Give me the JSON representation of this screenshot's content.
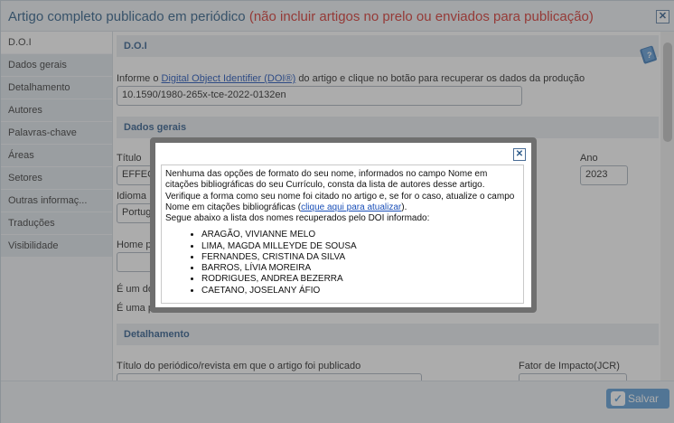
{
  "window": {
    "title": "Artigo completo publicado em periódico",
    "title_warning": "(não incluir artigos no prelo ou enviados para publicação)",
    "close_glyph": "✕"
  },
  "sidebar": {
    "items": [
      {
        "label": "D.O.I",
        "active": true
      },
      {
        "label": "Dados gerais"
      },
      {
        "label": "Detalhamento"
      },
      {
        "label": "Autores"
      },
      {
        "label": "Palavras-chave"
      },
      {
        "label": "Áreas"
      },
      {
        "label": "Setores"
      },
      {
        "label": "Outras informaç..."
      },
      {
        "label": "Traduções"
      },
      {
        "label": "Visibilidade"
      }
    ]
  },
  "doi_section": {
    "header": "D.O.I",
    "instruction_prefix": "Informe o",
    "instruction_link": "Digital Object Identifier (DOI®)",
    "instruction_suffix": "do artigo e clique no botão para recuperar os dados da produção",
    "doi_value": "10.1590/1980-265x-tce-2022-0132en"
  },
  "dados_gerais": {
    "header": "Dados gerais",
    "titulo_label": "Título",
    "titulo_value": "EFFEC",
    "ano_label": "Ano",
    "ano_value": "2023",
    "idioma_label": "Idioma",
    "idioma_value": "Portug",
    "homepage_label": "Home p",
    "e_um_label": "É um do",
    "e_uma_label": "É uma p"
  },
  "detalhamento": {
    "header": "Detalhamento",
    "periodico_label": "Título do periódico/revista em que o artigo foi publicado",
    "fator_label": "Fator de Impacto(JCR)"
  },
  "footer": {
    "save_label": "Salvar"
  },
  "modal": {
    "message_before_link": "Nenhuma das opções de formato do seu nome, informados no campo Nome em citações bibliográficas do seu Currículo, consta da lista de autores desse artigo. Verifique a forma como seu nome foi citado no artigo e, se for o caso, atualize o campo Nome em citações bibliográficas (",
    "link_text": "clique aqui para atualizar",
    "message_after_link": ").",
    "list_intro": "Segue abaixo a lista dos nomes recuperados pelo DOI informado:",
    "authors": [
      "ARAGÃO, VIVIANNE MELO",
      "LIMA, MAGDA MILLEYDE DE SOUSA",
      "FERNANDES, CRISTINA DA SILVA",
      "BARROS, LÍVIA MOREIRA",
      "RODRIGUES, ANDREA BEZERRA",
      "CAETANO, JOSELANY ÁFIO"
    ]
  }
}
